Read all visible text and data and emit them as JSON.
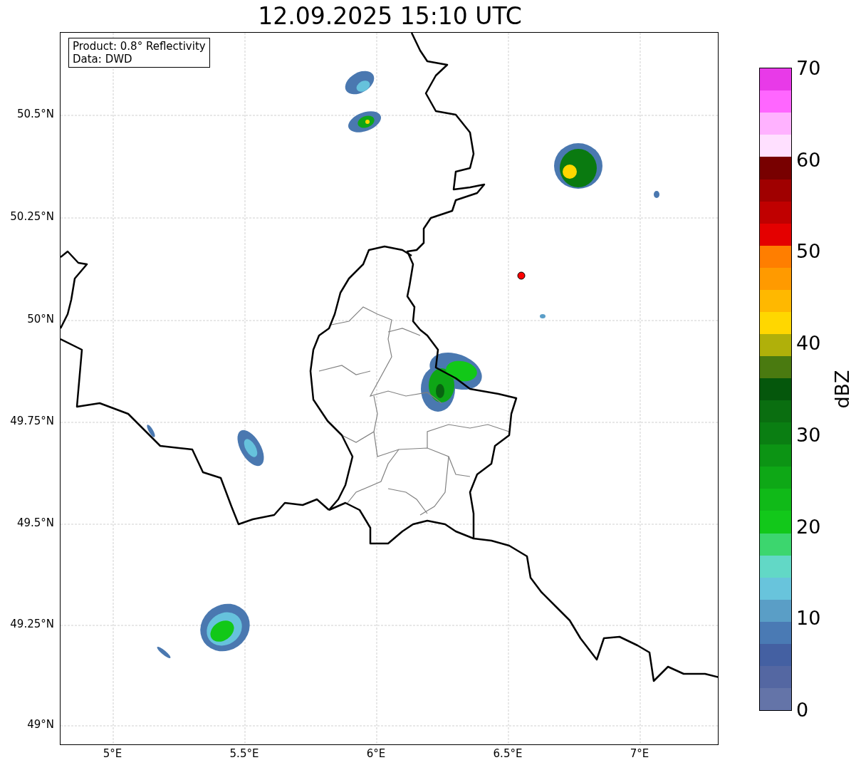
{
  "title": "12.09.2025 15:10 UTC",
  "info_box": {
    "lines": [
      "Product: 0.8° Reflectivity",
      "Data: DWD"
    ]
  },
  "y_ticks": [
    "50.5°N",
    "50.25°N",
    "50°N",
    "49.75°N",
    "49.5°N",
    "49.25°N",
    "49°N"
  ],
  "x_ticks": [
    "5°E",
    "5.5°E",
    "6°E",
    "6.5°E",
    "7°E"
  ],
  "colorbar": {
    "label": "dBZ",
    "ticks": [
      "70",
      "60",
      "50",
      "40",
      "30",
      "20",
      "10",
      "0"
    ],
    "segments": [
      {
        "color": "#6474a8"
      },
      {
        "color": "#5467a2"
      },
      {
        "color": "#4460a2"
      },
      {
        "color": "#4a7ab4"
      },
      {
        "color": "#5a9ec6"
      },
      {
        "color": "#68c4dc"
      },
      {
        "color": "#62d8c6"
      },
      {
        "color": "#3cd66e"
      },
      {
        "color": "#12c81a"
      },
      {
        "color": "#10ba18"
      },
      {
        "color": "#0ea816"
      },
      {
        "color": "#0c9414"
      },
      {
        "color": "#0a7e12"
      },
      {
        "color": "#0a6e10"
      },
      {
        "color": "#05570c"
      },
      {
        "color": "#4a7a10"
      },
      {
        "color": "#b0b00a"
      },
      {
        "color": "#ffd700"
      },
      {
        "color": "#ffb800"
      },
      {
        "color": "#ff9a00"
      },
      {
        "color": "#ff7e00"
      },
      {
        "color": "#e40000"
      },
      {
        "color": "#c00000"
      },
      {
        "color": "#a00000"
      },
      {
        "color": "#780000"
      },
      {
        "color": "#ffe0ff"
      },
      {
        "color": "#ffb2ff"
      },
      {
        "color": "#ff66ff"
      },
      {
        "color": "#e83ae8"
      }
    ]
  }
}
